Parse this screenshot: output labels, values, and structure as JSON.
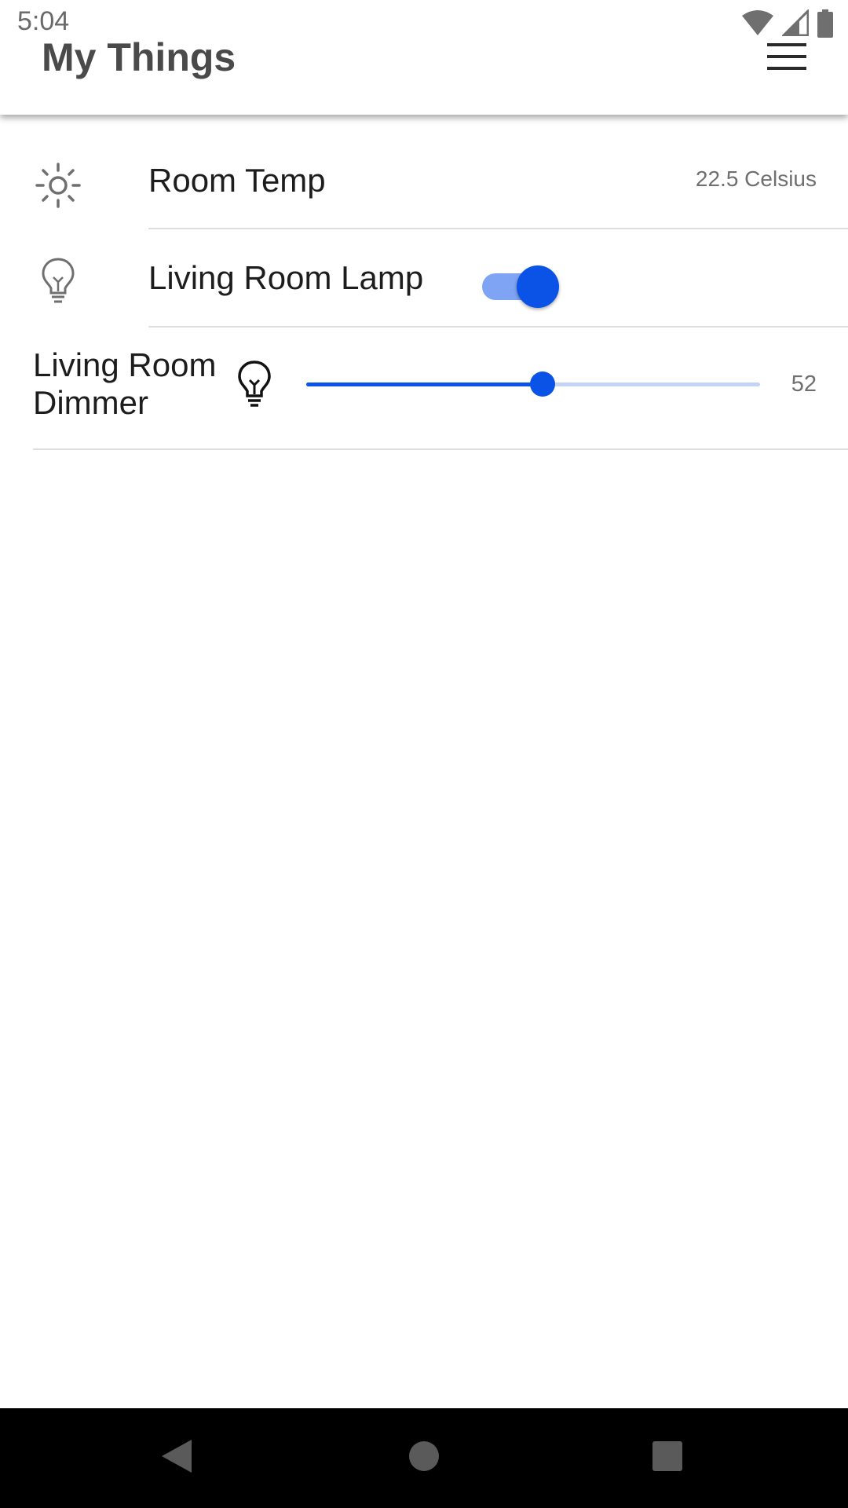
{
  "status_bar": {
    "time": "5:04",
    "icons": [
      "wifi-icon",
      "cell-signal-icon",
      "battery-icon"
    ]
  },
  "app_bar": {
    "title": "My Things",
    "menu_icon": "hamburger-menu-icon"
  },
  "things": {
    "temp": {
      "icon": "sun-icon",
      "label": "Room Temp",
      "value": "22.5 Celsius"
    },
    "lamp": {
      "icon": "lightbulb-outline-icon",
      "label": "Living Room Lamp",
      "on": true
    },
    "dimmer": {
      "icon": "lightbulb-icon",
      "label_line1": "Living Room",
      "label_line2": "Dimmer",
      "value": "52",
      "level_percent": 52
    }
  },
  "nav_bar": {
    "icons": [
      "back-icon",
      "home-icon",
      "recents-icon"
    ]
  },
  "colors": {
    "accent": "#0b53e6",
    "accent_light": "#7fa4f3",
    "track_light": "#c4d3f6",
    "divider": "#dedede"
  }
}
